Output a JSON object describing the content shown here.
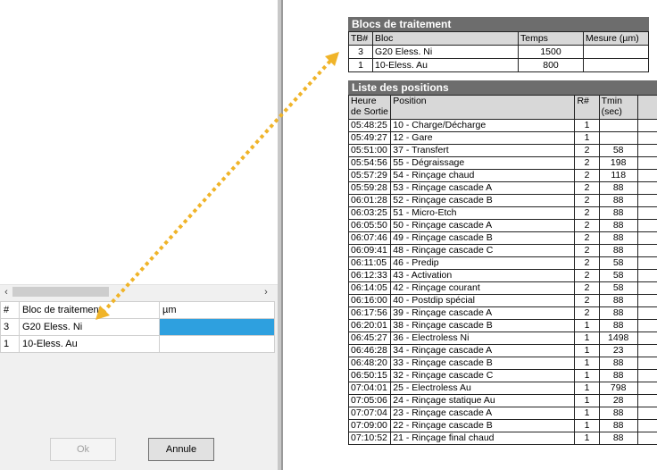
{
  "left_panel": {
    "grid_headers": [
      "#",
      "Bloc de traitement",
      "µm"
    ],
    "grid_rows": [
      {
        "num": "3",
        "bloc": "G20 Eless. Ni",
        "um": ""
      },
      {
        "num": "1",
        "bloc": "10-Eless. Au",
        "um": ""
      }
    ],
    "ok_label": "Ok",
    "annule_label": "Annule",
    "scroll_left_icon": "chevron-left-icon",
    "scroll_right_icon": "chevron-right-icon"
  },
  "report": {
    "blocs": {
      "title": "Blocs de traitement",
      "headers": [
        "TB#",
        "Bloc",
        "Temps",
        "Mesure (µm)"
      ],
      "rows": [
        [
          "3",
          "G20 Eless. Ni",
          "1500",
          ""
        ],
        [
          "1",
          "10-Eless. Au",
          "800",
          ""
        ]
      ]
    },
    "positions": {
      "title": "Liste des positions",
      "headers": [
        "Heure de Sortie",
        "Position",
        "R#",
        "Tmin (sec)"
      ],
      "rows": [
        [
          "05:48:25",
          "10 - Charge/Décharge",
          "1",
          ""
        ],
        [
          "05:49:27",
          "12 - Gare",
          "1",
          ""
        ],
        [
          "05:51:00",
          "37 - Transfert",
          "2",
          "58"
        ],
        [
          "05:54:56",
          "55 - Dégraissage",
          "2",
          "198"
        ],
        [
          "05:57:29",
          "54 - Rinçage chaud",
          "2",
          "118"
        ],
        [
          "05:59:28",
          "53 - Rinçage cascade A",
          "2",
          "88"
        ],
        [
          "06:01:28",
          "52 - Rinçage cascade B",
          "2",
          "88"
        ],
        [
          "06:03:25",
          "51 - Micro-Etch",
          "2",
          "88"
        ],
        [
          "06:05:50",
          "50 - Rinçage cascade A",
          "2",
          "88"
        ],
        [
          "06:07:46",
          "49 - Rinçage cascade B",
          "2",
          "88"
        ],
        [
          "06:09:41",
          "48 - Rinçage cascade C",
          "2",
          "88"
        ],
        [
          "06:11:05",
          "46 - Predip",
          "2",
          "58"
        ],
        [
          "06:12:33",
          "43 - Activation",
          "2",
          "58"
        ],
        [
          "06:14:05",
          "42 - Rinçage courant",
          "2",
          "58"
        ],
        [
          "06:16:00",
          "40 - Postdip spécial",
          "2",
          "88"
        ],
        [
          "06:17:56",
          "39 - Rinçage cascade A",
          "2",
          "88"
        ],
        [
          "06:20:01",
          "38 - Rinçage cascade B",
          "1",
          "88"
        ],
        [
          "06:45:27",
          "36 - Electroless Ni",
          "1",
          "1498"
        ],
        [
          "06:46:28",
          "34 - Rinçage cascade A",
          "1",
          "23"
        ],
        [
          "06:48:20",
          "33 -  Rinçage cascade B",
          "1",
          "88"
        ],
        [
          "06:50:15",
          "32 - Rinçage cascade C",
          "1",
          "88"
        ],
        [
          "07:04:01",
          "25 - Electroless Au",
          "1",
          "798"
        ],
        [
          "07:05:06",
          "24 - Rinçage statique Au",
          "1",
          "28"
        ],
        [
          "07:07:04",
          "23 - Rinçage cascade A",
          "1",
          "88"
        ],
        [
          "07:09:00",
          "22 - Rinçage cascade B",
          "1",
          "88"
        ],
        [
          "07:10:52",
          "21 - Rinçage final chaud",
          "1",
          "88"
        ]
      ]
    }
  },
  "annotation": {
    "color": "#f0b429",
    "icon": "double-arrow-icon"
  }
}
